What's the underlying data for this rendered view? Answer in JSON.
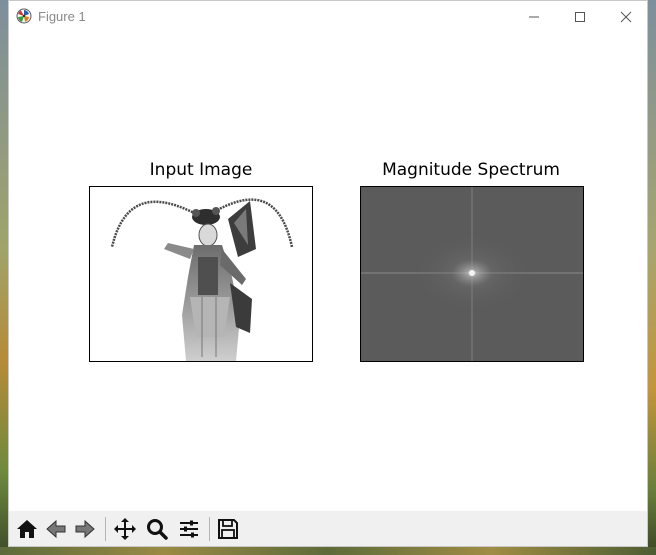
{
  "window": {
    "title": "Figure 1"
  },
  "figure": {
    "subplots": [
      {
        "title": "Input Image"
      },
      {
        "title": "Magnitude Spectrum"
      }
    ]
  },
  "toolbar": {
    "buttons": [
      {
        "name": "home-icon",
        "tooltip": "Reset original view"
      },
      {
        "name": "back-arrow-icon",
        "tooltip": "Back to previous view"
      },
      {
        "name": "forward-arrow-icon",
        "tooltip": "Forward to next view"
      },
      {
        "name": "pan-move-icon",
        "tooltip": "Pan axes"
      },
      {
        "name": "zoom-magnifier-icon",
        "tooltip": "Zoom to rectangle"
      },
      {
        "name": "configure-subplots-icon",
        "tooltip": "Configure subplots"
      },
      {
        "name": "save-disk-icon",
        "tooltip": "Save the figure"
      }
    ]
  },
  "colors": {
    "spectrum_background": "#5b5b5b",
    "toolbar_background": "#f0f0f0",
    "title_text": "#8a8a8a"
  }
}
